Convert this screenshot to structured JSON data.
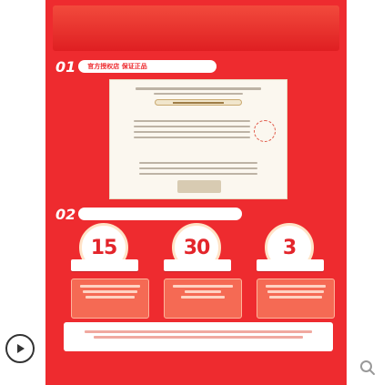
{
  "poster": {
    "title": "",
    "section1": {
      "number": "01",
      "tab": "官方授权店 保证正品"
    },
    "certificate": {
      "heading": "",
      "signature": ""
    },
    "section2": {
      "number": "02",
      "tab": ""
    },
    "badges": [
      {
        "number": "15",
        "unit": "",
        "label": ""
      },
      {
        "number": "30",
        "unit": "",
        "label": ""
      },
      {
        "number": "3",
        "unit": "",
        "label": ""
      }
    ],
    "cards": [
      {
        "title": ""
      },
      {
        "title": ""
      },
      {
        "title": ""
      }
    ],
    "footer": {
      "text": ""
    }
  },
  "icons": {
    "play": "play-icon",
    "search": "search-icon"
  },
  "colors": {
    "brand_red": "#ee2b2f",
    "badge_red": "#e3252b",
    "card_bg": "#f56a54"
  }
}
